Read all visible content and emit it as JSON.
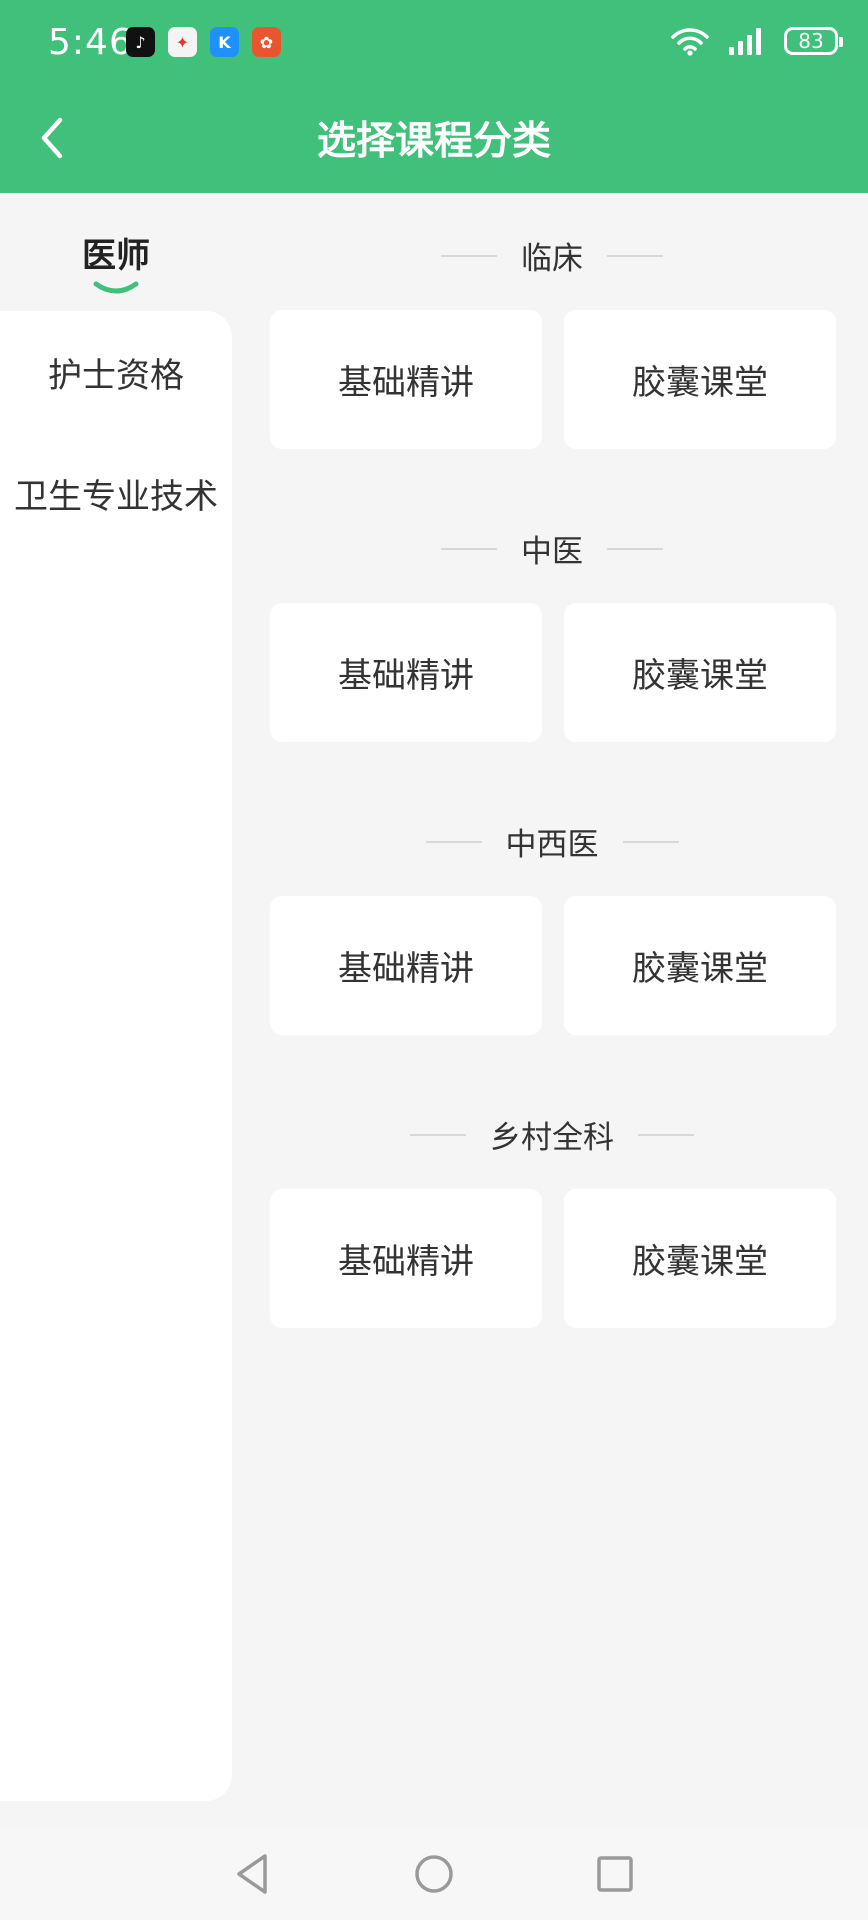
{
  "status_bar": {
    "time": "5:46",
    "app_icons": [
      "tiktok-icon",
      "app-red-icon",
      "app-blue-icon",
      "app-orange-icon"
    ],
    "battery": "83"
  },
  "header": {
    "title": "选择课程分类",
    "background": "#40c07a"
  },
  "sidebar": {
    "active": "医师",
    "items": [
      "护士资格",
      "卫生专业技术"
    ]
  },
  "sections": [
    {
      "title": "临床",
      "cards": [
        "基础精讲",
        "胶囊课堂"
      ]
    },
    {
      "title": "中医",
      "cards": [
        "基础精讲",
        "胶囊课堂"
      ]
    },
    {
      "title": "中西医",
      "cards": [
        "基础精讲",
        "胶囊课堂"
      ]
    },
    {
      "title": "乡村全科",
      "cards": [
        "基础精讲",
        "胶囊课堂"
      ]
    }
  ]
}
